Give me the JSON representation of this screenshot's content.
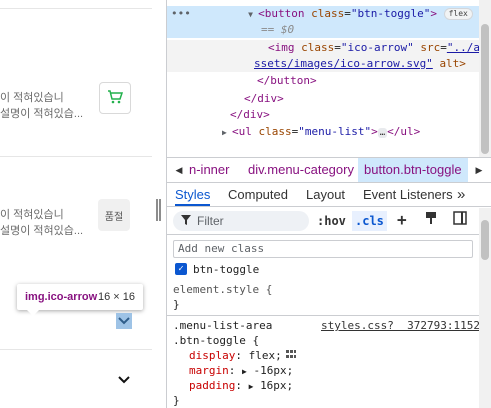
{
  "page": {
    "item1_desc1": "이 적혀있습니",
    "item1_desc2": "설명이 적혀있습...",
    "item2_desc1": "이 적혀있습니",
    "item2_desc2": "설명이 적혀있습...",
    "soldout_label": "품절",
    "cart_icon": "cart-icon",
    "cart_color": "#22b14c",
    "tooltip_tag": "img.ico-arrow",
    "tooltip_size": "16 × 16"
  },
  "dom": {
    "dots": "•••",
    "btn_open_tag": "<button",
    "btn_class_attr": "class",
    "btn_class_val": "\"btn-toggle\"",
    "btn_close": ">",
    "flex_badge": "flex",
    "dollar0": "== $0",
    "img_open": "<img",
    "img_class_attr": "class",
    "img_class_val": "\"ico-arrow\"",
    "img_src_attr": "src",
    "img_src_val1": "\"../a",
    "img_src_val2": "ssets/images/ico-arrow.svg\"",
    "img_alt": "alt>",
    "btn_end": "</button>",
    "div_end1": "</div>",
    "div_end2": "</div>",
    "ul_open": "<ul",
    "ul_class_attr": "class",
    "ul_class_val": "\"menu-list\"",
    "ul_close": ">",
    "ul_end": "</ul>",
    "ellipsis": "…"
  },
  "breadcrumbs": {
    "items": [
      "n-inner",
      "div.menu-category",
      "button.btn-toggle"
    ]
  },
  "tabs": {
    "items": [
      "Styles",
      "Computed",
      "Layout",
      "Event Listeners"
    ],
    "more": "»"
  },
  "filter": {
    "placeholder": "Filter",
    "hov": ":hov",
    "cls": ".cls"
  },
  "classes": {
    "add_placeholder": "Add new class",
    "class_name": "btn-toggle"
  },
  "styles": {
    "element_style_sel": "element.style {",
    "element_style_end": "}",
    "rule_sel1": ".menu-list-area",
    "rule_sel2": ".btn-toggle {",
    "rule_source": "styles.css?  372793:1152",
    "p1_name": "display",
    "p1_val": "flex;",
    "p2_name": "margin",
    "p2_val": "-16px;",
    "p3_name": "padding",
    "p3_val": "16px;",
    "rule_end": "}"
  }
}
